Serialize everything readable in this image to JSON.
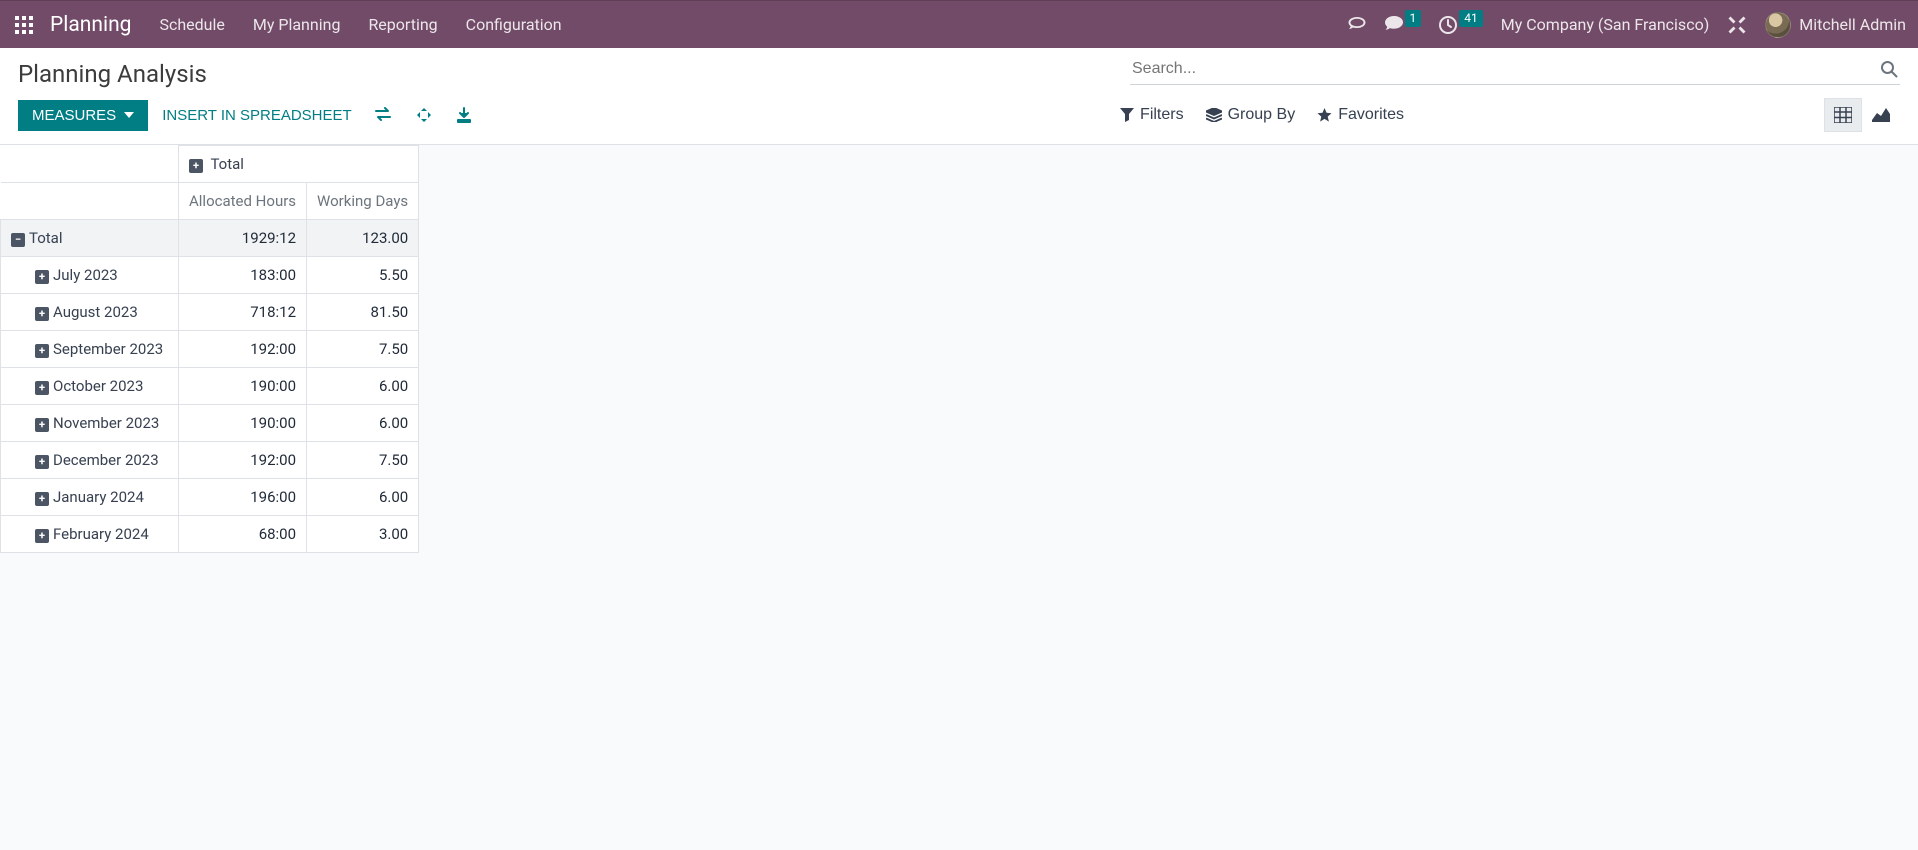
{
  "navbar": {
    "brand": "Planning",
    "menu": [
      "Schedule",
      "My Planning",
      "Reporting",
      "Configuration"
    ],
    "messages_badge": "1",
    "activities_badge": "41",
    "company": "My Company (San Francisco)",
    "username": "Mitchell Admin"
  },
  "control_panel": {
    "title": "Planning Analysis",
    "search_placeholder": "Search...",
    "measures_label": "MEASURES",
    "insert_label": "INSERT IN SPREADSHEET",
    "filters_label": "Filters",
    "groupby_label": "Group By",
    "favorites_label": "Favorites"
  },
  "pivot": {
    "col_total": "Total",
    "measures": [
      "Allocated Hours",
      "Working Days"
    ],
    "row_total": "Total",
    "total_values": [
      "1929:12",
      "123.00"
    ],
    "rows": [
      {
        "label": "July 2023",
        "values": [
          "183:00",
          "5.50"
        ]
      },
      {
        "label": "August 2023",
        "values": [
          "718:12",
          "81.50"
        ]
      },
      {
        "label": "September 2023",
        "values": [
          "192:00",
          "7.50"
        ]
      },
      {
        "label": "October 2023",
        "values": [
          "190:00",
          "6.00"
        ]
      },
      {
        "label": "November 2023",
        "values": [
          "190:00",
          "6.00"
        ]
      },
      {
        "label": "December 2023",
        "values": [
          "192:00",
          "7.50"
        ]
      },
      {
        "label": "January 2024",
        "values": [
          "196:00",
          "6.00"
        ]
      },
      {
        "label": "February 2024",
        "values": [
          "68:00",
          "3.00"
        ]
      }
    ]
  }
}
